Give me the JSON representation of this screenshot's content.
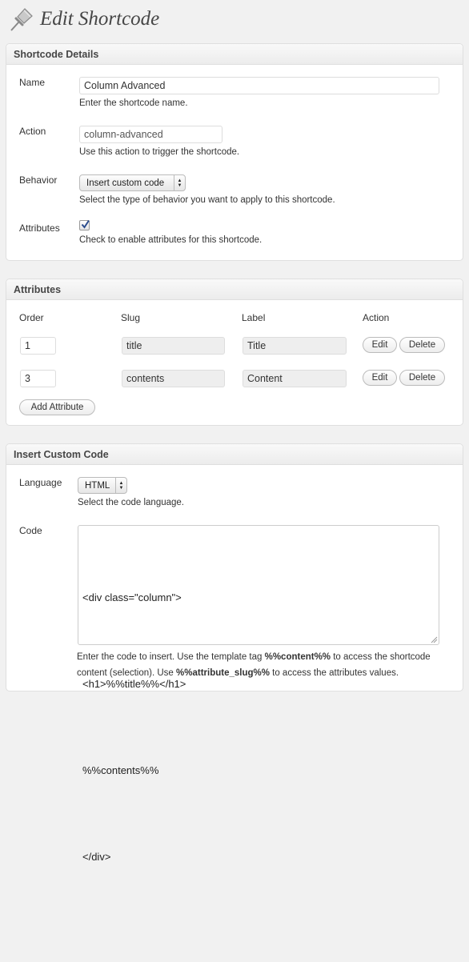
{
  "page": {
    "title": "Edit Shortcode"
  },
  "details": {
    "title": "Shortcode Details",
    "name_label": "Name",
    "name_value": "Column Advanced",
    "name_desc": "Enter the shortcode name.",
    "action_label": "Action",
    "action_value": "column-advanced",
    "action_desc": "Use this action to trigger the shortcode.",
    "behavior_label": "Behavior",
    "behavior_value": "Insert custom code",
    "behavior_desc": "Select the type of behavior you want to apply to this shortcode.",
    "attributes_label": "Attributes",
    "attributes_checked": true,
    "attributes_desc": "Check to enable attributes for this shortcode."
  },
  "attributes": {
    "title": "Attributes",
    "columns": [
      "Order",
      "Slug",
      "Label",
      "Action"
    ],
    "rows": [
      {
        "order": "1",
        "slug": "title",
        "label": "Title"
      },
      {
        "order": "3",
        "slug": "contents",
        "label": "Content"
      }
    ],
    "edit_label": "Edit",
    "delete_label": "Delete",
    "add_label": "Add Attribute"
  },
  "custom_code": {
    "title": "Insert Custom Code",
    "language_label": "Language",
    "language_value": "HTML",
    "language_desc": "Select the code language.",
    "code_label": "Code",
    "code_lines": [
      "<div class=\"column\">",
      "<h1>%%title%%</h1>",
      "%%contents%%",
      "</div>"
    ],
    "help_part1": "Enter the code to insert. Use the template tag ",
    "help_tag1": "%%content%%",
    "help_part2": " to access the shortcode content (selection). Use ",
    "help_tag2": "%%attribute_slug%%",
    "help_part3": " to access the attributes values."
  }
}
